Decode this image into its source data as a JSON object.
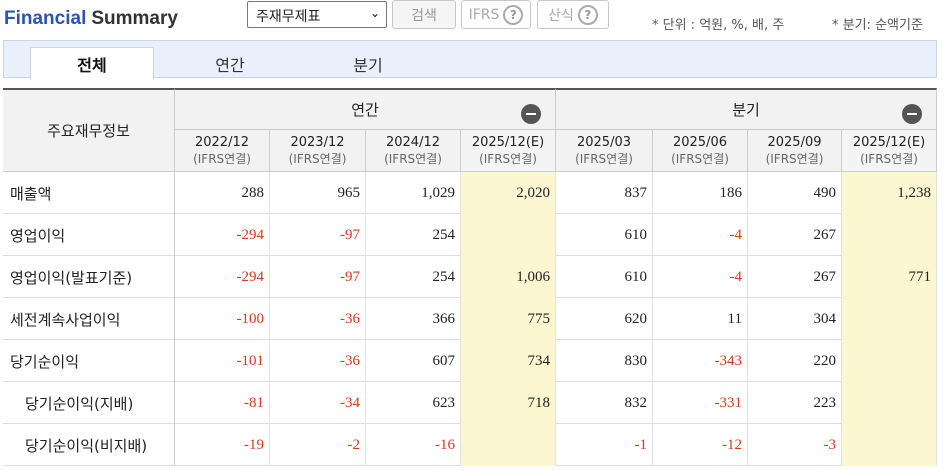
{
  "header": {
    "title_part1": "Financial",
    "title_part2": "Summary",
    "statement_select": "주재무제표",
    "search_label": "검색",
    "ifrs_label": "IFRS",
    "calc_label": "산식",
    "unit_note": "* 단위 : 억원, %, 배, 주",
    "quarter_note": "* 분기: 순액기준"
  },
  "tabs": [
    {
      "label": "전체"
    },
    {
      "label": "연간"
    },
    {
      "label": "분기"
    }
  ],
  "table": {
    "corner_label": "주요재무정보",
    "groups": {
      "annual": "연간",
      "quarterly": "분기"
    },
    "columns": [
      {
        "period": "2022/12",
        "basis": "(IFRS연결)"
      },
      {
        "period": "2023/12",
        "basis": "(IFRS연결)"
      },
      {
        "period": "2024/12",
        "basis": "(IFRS연결)"
      },
      {
        "period": "2025/12(E)",
        "basis": "(IFRS연결)"
      },
      {
        "period": "2025/03",
        "basis": "(IFRS연결)"
      },
      {
        "period": "2025/06",
        "basis": "(IFRS연결)"
      },
      {
        "period": "2025/09",
        "basis": "(IFRS연결)"
      },
      {
        "period": "2025/12(E)",
        "basis": "(IFRS연결)"
      }
    ],
    "rows": [
      {
        "label": "매출액",
        "values": [
          "288",
          "965",
          "1,029",
          "2,020",
          "837",
          "186",
          "490",
          "1,238"
        ]
      },
      {
        "label": "영업이익",
        "values": [
          "-294",
          "-97",
          "254",
          "",
          "610",
          "-4",
          "267",
          ""
        ]
      },
      {
        "label": "영업이익(발표기준)",
        "values": [
          "-294",
          "-97",
          "254",
          "1,006",
          "610",
          "-4",
          "267",
          "771"
        ]
      },
      {
        "label": "세전계속사업이익",
        "values": [
          "-100",
          "-36",
          "366",
          "775",
          "620",
          "11",
          "304",
          ""
        ]
      },
      {
        "label": "당기순이익",
        "values": [
          "-101",
          "-36",
          "607",
          "734",
          "830",
          "-343",
          "220",
          ""
        ]
      },
      {
        "label": "당기순이익(지배)",
        "values": [
          "-81",
          "-34",
          "623",
          "718",
          "832",
          "-331",
          "223",
          ""
        ]
      },
      {
        "label": "당기순이익(비지배)",
        "values": [
          "-19",
          "-2",
          "-16",
          "",
          "-1",
          "-12",
          "-3",
          ""
        ]
      }
    ]
  },
  "colors": {
    "accent": "#2a55b0",
    "negative": "#d63a1a",
    "estimate_bg": "#fcf7d1"
  }
}
